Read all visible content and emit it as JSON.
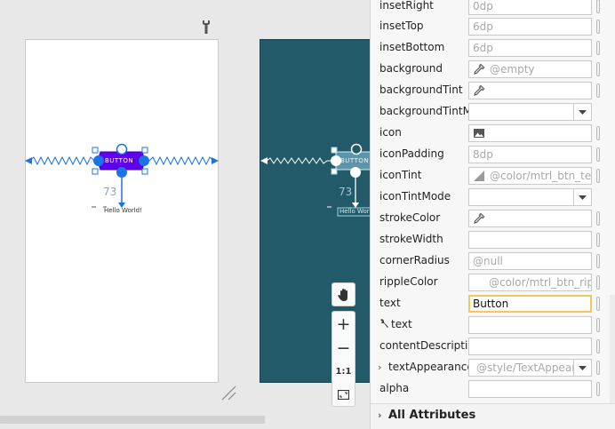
{
  "canvas": {
    "design_view": {
      "button_label": "BUTTON",
      "margin_value": "73",
      "textview_text": "Hello World!"
    },
    "blueprint_view": {
      "button_label": "BUTTON",
      "margin_value": "73",
      "textview_text": "Hello World"
    },
    "zoom_toolbar": {
      "zoom_in": "+",
      "zoom_out": "−",
      "actual_size": "1:1"
    },
    "colors": {
      "button_fill": "#6200ee",
      "handle_blue": "#1a73e8",
      "blueprint_bg": "#235a6a",
      "blueprint_line": "#9fd3e2"
    }
  },
  "attributes": [
    {
      "label": "insetRight",
      "value": "0dp",
      "kind": "text"
    },
    {
      "label": "insetTop",
      "value": "6dp",
      "kind": "text"
    },
    {
      "label": "insetBottom",
      "value": "6dp",
      "kind": "text"
    },
    {
      "label": "background",
      "value": "@empty",
      "kind": "picker"
    },
    {
      "label": "backgroundTint",
      "value": "",
      "kind": "picker"
    },
    {
      "label": "backgroundTintM…",
      "value": "",
      "kind": "dropdown"
    },
    {
      "label": "icon",
      "value": "",
      "kind": "image"
    },
    {
      "label": "iconPadding",
      "value": "8dp",
      "kind": "text"
    },
    {
      "label": "iconTint",
      "value": "@color/mtrl_btn_text_",
      "kind": "swatch"
    },
    {
      "label": "iconTintMode",
      "value": "",
      "kind": "dropdown"
    },
    {
      "label": "strokeColor",
      "value": "",
      "kind": "picker"
    },
    {
      "label": "strokeWidth",
      "value": "",
      "kind": "text"
    },
    {
      "label": "cornerRadius",
      "value": "@null",
      "kind": "text"
    },
    {
      "label": "rippleColor",
      "value": "@color/mtrl_btn_ripp",
      "kind": "indent"
    },
    {
      "label": "text",
      "value": "Button",
      "kind": "active"
    },
    {
      "label": "text",
      "value": "",
      "kind": "tools-text"
    },
    {
      "label": "contentDescription",
      "value": "",
      "kind": "text"
    },
    {
      "label": "textAppearance",
      "value": "@style/TextAppeara",
      "kind": "dropdown-expand"
    },
    {
      "label": "alpha",
      "value": "",
      "kind": "text"
    }
  ],
  "all_attributes_label": "All Attributes",
  "caret_collapsed": "›"
}
